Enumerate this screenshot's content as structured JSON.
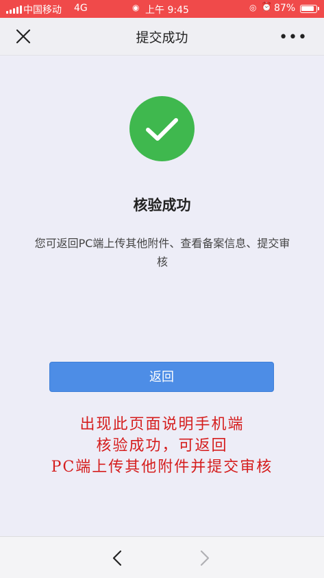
{
  "status_bar": {
    "carrier": "中国移动",
    "network": "4G",
    "time": "上午 9:45",
    "battery": "87%"
  },
  "nav": {
    "title": "提交成功",
    "close_icon": "close-icon",
    "more_icon": "more-icon"
  },
  "main": {
    "heading": "核验成功",
    "description": "您可返回PC端上传其他附件、查看备案信息、提交审核",
    "button_label": "返回",
    "success_icon": "check-circle-icon"
  },
  "annotation": {
    "lines": [
      "出现此页面说明手机端",
      "核验成功，可返回",
      "PC端上传其他附件并提交审核"
    ]
  },
  "colors": {
    "status_bar": "#f04a4a",
    "success": "#3fb84e",
    "button": "#4d8de6",
    "annotation": "#d51d1d"
  }
}
